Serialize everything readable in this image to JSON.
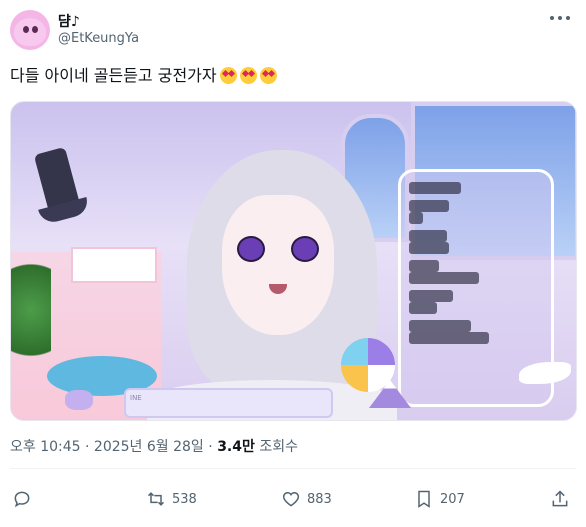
{
  "author": {
    "display_name": "댬♪",
    "handle": "@EtKeungYa"
  },
  "tweet": {
    "text": "다들 아이네 골든듣고 궁전가자",
    "emoji_count": 3,
    "emoji_icon": "heart-eyes-emoji"
  },
  "media": {
    "keyboard_text": "INE",
    "chat_rows": 11
  },
  "meta": {
    "time": "오후 10:45",
    "separator1": " · ",
    "date": "2025년 6월 28일",
    "separator2": " · ",
    "views_count": "3.4만",
    "views_label": " 조회수"
  },
  "actions": {
    "reply_count": "",
    "retweet_count": "538",
    "like_count": "883",
    "bookmark_count": "207"
  },
  "colors": {
    "text_primary": "#0f1419",
    "text_secondary": "#536471",
    "divider": "#eff3f4"
  }
}
